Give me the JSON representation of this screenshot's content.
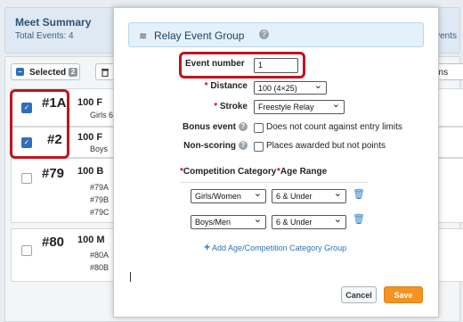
{
  "summary": {
    "title": "Meet Summary",
    "total": "Total Events: 4",
    "right_text": "Events"
  },
  "toolbar": {
    "selected_label": "Selected",
    "selected_count": "2",
    "options_label": "ons"
  },
  "events": [
    {
      "num": "#1A",
      "head": "100 F",
      "sub": "Girls 6",
      "checked": true
    },
    {
      "num": "#2",
      "head": "100 F",
      "sub": "Boys",
      "checked": true
    },
    {
      "num": "#79",
      "head": "100 B",
      "subs": [
        "#79A",
        "#79B",
        "#79C"
      ],
      "checked": false
    },
    {
      "num": "#80",
      "head": "100 M",
      "subs": [
        "#80A",
        "#80B"
      ],
      "checked": false
    }
  ],
  "modal": {
    "title": "Relay Event Group",
    "event_number_label": "Event number",
    "event_number_value": "1",
    "distance_label": "Distance",
    "distance_value": "100 (4×25)",
    "stroke_label": "Stroke",
    "stroke_value": "Freestyle Relay",
    "bonus_label": "Bonus event",
    "bonus_text": "Does not count against entry limits",
    "nonscoring_label": "Non-scoring",
    "nonscoring_text": "Places awarded but not points",
    "comp_cat_label": "Competition Category",
    "age_range_label": "Age Range",
    "groups": [
      {
        "category": "Girls/Women",
        "age": "6 & Under"
      },
      {
        "category": "Boys/Men",
        "age": "6 & Under"
      }
    ],
    "add_group_label": "Add Age/Competition Category Group",
    "cancel_label": "Cancel",
    "save_label": "Save"
  },
  "colors": {
    "highlight": "#c0141d",
    "save": "#f39322",
    "link": "#2e74b8"
  }
}
